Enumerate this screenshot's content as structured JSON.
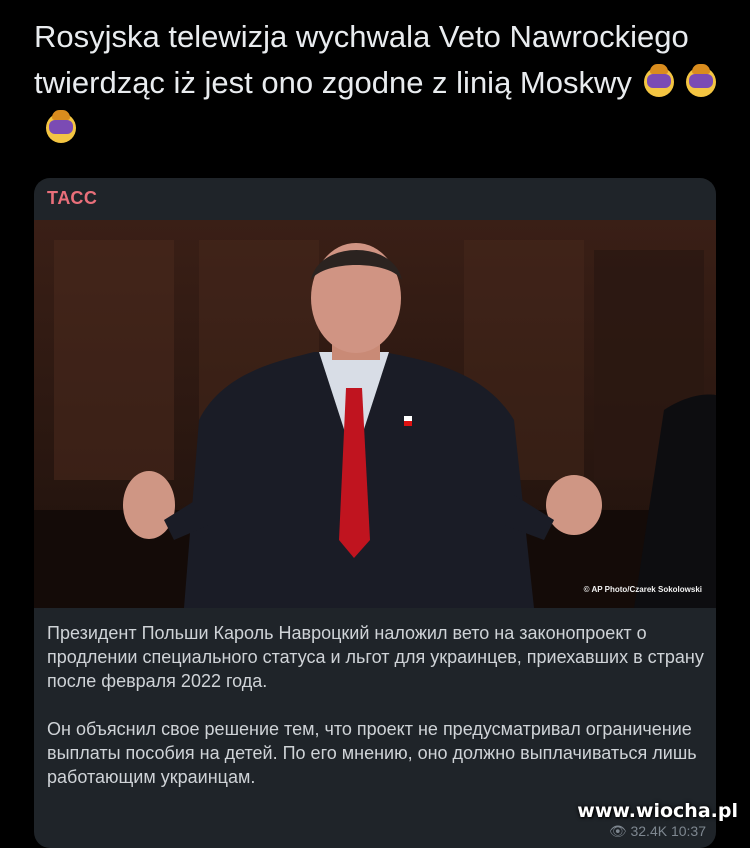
{
  "post": {
    "text": "Rosyjska telewizja wychwala Veto Nawrockiego twierdząc iż jest ono zgodne z linią Moskwy",
    "emojis": [
      "facepalm-emoji",
      "facepalm-emoji",
      "facepalm-emoji"
    ]
  },
  "card": {
    "channel": "ТАСС",
    "photo_credit": "© AP Photo/Czarek Sokolowski",
    "paragraph1": "Президент Польши Кароль Навроцкий наложил вето на законопроект о продлении специального статуса и льгот для украинцев, приехавших в страну после февраля 2022 года.",
    "paragraph2": "Он объяснил свое решение тем, что проект не предусматривал ограничение выплаты пособия на детей. По его мнению, оно должно выплачиваться лишь работающим украинцам.",
    "meta": "👁 32.4K  10:37"
  },
  "watermark": "www.wiocha.pl",
  "colors": {
    "background": "#000000",
    "card": "#1f2429",
    "channel": "#e96f7a",
    "post_text": "#e9ecef"
  }
}
